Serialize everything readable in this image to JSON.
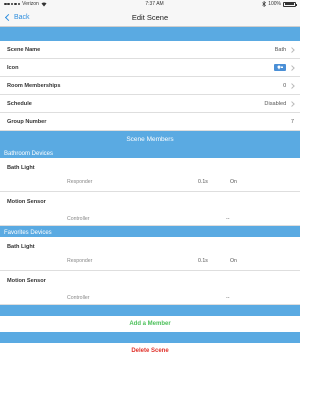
{
  "status_bar": {
    "carrier": "Verizon",
    "time": "7:37 AM",
    "battery": "100%"
  },
  "nav": {
    "back_label": "Back",
    "title": "Edit Scene"
  },
  "settings": [
    {
      "label": "Scene Name",
      "value": "Bath",
      "chevron": true
    },
    {
      "label": "Icon",
      "value": "",
      "icon": "light-bulb-icon",
      "chevron": true
    },
    {
      "label": "Room Memberships",
      "value": "0",
      "chevron": true
    },
    {
      "label": "Schedule",
      "value": "Disabled",
      "chevron": true
    },
    {
      "label": "Group Number",
      "value": "7",
      "chevron": false
    }
  ],
  "members_header": "Scene Members",
  "groups": [
    {
      "title": "Bathroom Devices",
      "members": [
        {
          "name": "Bath Light",
          "role": "Responder",
          "ramp": "0.1s",
          "level": "On"
        },
        {
          "name": "Motion Sensor",
          "role": "Controller",
          "ramp": "--",
          "level": ""
        }
      ]
    },
    {
      "title": "Favorites Devices",
      "members": [
        {
          "name": "Bath Light",
          "role": "Responder",
          "ramp": "0.1s",
          "level": "On"
        },
        {
          "name": "Motion Sensor",
          "role": "Controller",
          "ramp": "--",
          "level": ""
        }
      ]
    }
  ],
  "actions": {
    "add_label": "Add a Member",
    "delete_label": "Delete Scene"
  },
  "colors": {
    "band": "#5aaae2",
    "accent": "#2e8ede",
    "add": "#4cc05a",
    "delete": "#e0312a"
  }
}
